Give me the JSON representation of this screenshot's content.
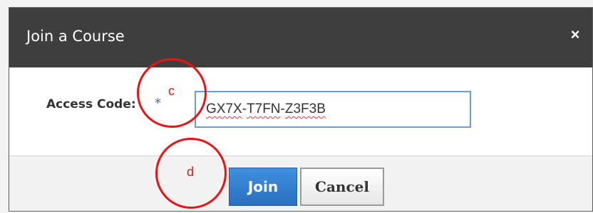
{
  "dialog": {
    "title": "Join a Course",
    "close_glyph": "×",
    "close_icon": "close-icon"
  },
  "form": {
    "access_code_label": "Access Code:",
    "required_marker": "*",
    "access_code_value": [
      "GX7X",
      "-",
      "T7FN",
      "-",
      "Z3F3B"
    ]
  },
  "footer": {
    "join_label": "Join",
    "cancel_label": "Cancel"
  },
  "annotations": {
    "c": "c",
    "d": "d",
    "color": "#ee1111"
  },
  "colors": {
    "titlebar": "#3e3e3e",
    "primary_button": "#2f7fd6",
    "required_marker": "#3a6fc4",
    "input_border": "#6f9ad6"
  }
}
